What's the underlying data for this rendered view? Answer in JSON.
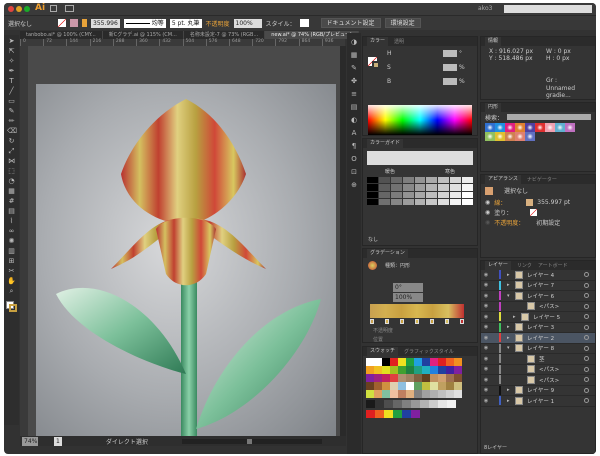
{
  "title_bar": {
    "app_logo": "Ai",
    "user": "ako3",
    "search_placeholder": ""
  },
  "control_bar": {
    "selection": "選択なし",
    "stroke_weight": "355.996",
    "stroke_profile": "均等",
    "brush": "5 pt. 丸筆",
    "opacity_label": "不透明度",
    "opacity": "100%",
    "style_label": "スタイル：",
    "doc_setup": "ドキュメント設定",
    "prefs": "環境設定"
  },
  "tabs": [
    "tanbobo.ai* @ 100% (CMY...",
    "新Cグラデ.ai @ 115% (CM...",
    "名称未設定-7 @ 73% (RGB...",
    "new.ai* @ 74% (RGB/プレビュー)"
  ],
  "ruler": [
    "0",
    "72",
    "144",
    "216",
    "288",
    "360",
    "432",
    "504",
    "576",
    "648",
    "720",
    "792",
    "864",
    "936"
  ],
  "status": {
    "zoom": "74%",
    "page": "1",
    "tool": "ダイレクト選択"
  },
  "color_panel": {
    "tabs": [
      "カラー",
      "透明"
    ],
    "labels": [
      "H",
      "S",
      "B"
    ],
    "units": [
      "°",
      "%",
      "%"
    ]
  },
  "color_guide": {
    "title": "カラーガイド",
    "labels": [
      "暖色",
      "寒色"
    ],
    "footer": "なし"
  },
  "gradient": {
    "title": "グラデーション",
    "type_label": "種類：",
    "type": "円形",
    "angle": "0°",
    "ratio": "100%",
    "opacity_label": "不透明度",
    "position_label": "位置",
    "stops": [
      "#c8a050",
      "#d4b050",
      "#c9a040",
      "#d8b850",
      "#c8a040",
      "#d8c060",
      "#c03030"
    ]
  },
  "swatches": {
    "tabs": [
      "スウォッチ",
      "グラフィックスタイル"
    ],
    "colors": [
      "#ffffff",
      "#ffffff",
      "#000000",
      "#e02020",
      "#f0e020",
      "#20a040",
      "#20a0e0",
      "#2040a0",
      "#e02080",
      "#e02020",
      "#f06020",
      "#f09020",
      "#f0a020",
      "#f0c020",
      "#e0e020",
      "#a0c020",
      "#40a030",
      "#208040",
      "#20a080",
      "#20b0c0",
      "#2080e0",
      "#2040a0",
      "#4020a0",
      "#8020a0",
      "#8020a0",
      "#a02080",
      "#c02060",
      "#e04040",
      "#b09070",
      "#a08060",
      "#806040",
      "#604020",
      "#c09060",
      "#d0a070",
      "#a07050",
      "#805030",
      "#6a4020",
      "#a06030",
      "#d09040",
      "#e0d0b0",
      "#90c0e0",
      "#ffffff",
      "#60a060",
      "#c0c040",
      "#e0e0a0",
      "#c0a060",
      "#a08040",
      "#d0c080",
      "#d0e040",
      "#e0a060",
      "#80c0a0",
      "#f0c0a0",
      "#c08060",
      "#e0b080",
      "#808080",
      "#a0a0a0",
      "#b0b0b0",
      "#c0c0c0",
      "#d0d0d0",
      "#e0e0e0"
    ],
    "group2": [
      "#1a1a1a",
      "#333333",
      "#4d4d4d",
      "#666666",
      "#808080",
      "#999999",
      "#b3b3b3",
      "#cccccc",
      "#e6e6e6",
      "#f2f2f2"
    ],
    "group3": [
      "#e02020",
      "#f06020",
      "#f0e020",
      "#20a040",
      "#2040a0",
      "#8020a0"
    ]
  },
  "info": {
    "title": "情報",
    "x": "X : 916.027 px",
    "y": "Y : 518.486 px",
    "w": "W : 0 px",
    "h": "H : 0 px",
    "gr": "Gr :",
    "gradient_name": "Unnamed gradie..."
  },
  "brushes": {
    "title": "円形",
    "search_label": "検索：",
    "colors": [
      "#3070d0",
      "#2090e0",
      "#e02080",
      "#e08030",
      "#5040a0",
      "#e03030",
      "#f0a0b0",
      "#60b0d0",
      "#c070c0",
      "#90c060",
      "#e0c030",
      "#d08050",
      "#e08070",
      "#6070c0"
    ]
  },
  "appearance": {
    "tabs": [
      "アピアランス",
      "ナビゲーター"
    ],
    "target": "選択なし",
    "stroke_label": "線：",
    "stroke_value": "355.997 pt",
    "fill_label": "塗り：",
    "opacity_label": "不透明度：",
    "opacity_value": "初期設定"
  },
  "layers": {
    "tabs": [
      "レイヤー",
      "リンク",
      "アートボード"
    ],
    "footer": "8レイヤー",
    "items": [
      {
        "name": "レイヤー 4",
        "color": "#4050c0",
        "indent": 0,
        "arrow": "▸"
      },
      {
        "name": "レイヤー 7",
        "color": "#40c0e0",
        "indent": 0,
        "arrow": "▸"
      },
      {
        "name": "レイヤー 6",
        "color": "#c040c0",
        "indent": 0,
        "arrow": "▾"
      },
      {
        "name": "<パス>",
        "color": "#c040c0",
        "indent": 2,
        "arrow": ""
      },
      {
        "name": "レイヤー 5",
        "color": "#e0e040",
        "indent": 1,
        "arrow": "▸"
      },
      {
        "name": "レイヤー 3",
        "color": "#40c060",
        "indent": 0,
        "arrow": "▸"
      },
      {
        "name": "レイヤー 2",
        "color": "#e04040",
        "indent": 0,
        "arrow": "▸"
      },
      {
        "name": "レイヤー 8",
        "color": "#888888",
        "indent": 0,
        "arrow": "▾"
      },
      {
        "name": "茎",
        "color": "#888888",
        "indent": 2,
        "arrow": ""
      },
      {
        "name": "<パス>",
        "color": "#888888",
        "indent": 2,
        "arrow": ""
      },
      {
        "name": "<パス>",
        "color": "#888888",
        "indent": 2,
        "arrow": ""
      },
      {
        "name": "レイヤー 9",
        "color": "#111111",
        "indent": 0,
        "arrow": "▸"
      },
      {
        "name": "レイヤー 1",
        "color": "#4060c0",
        "indent": 0,
        "arrow": "▸"
      }
    ]
  }
}
